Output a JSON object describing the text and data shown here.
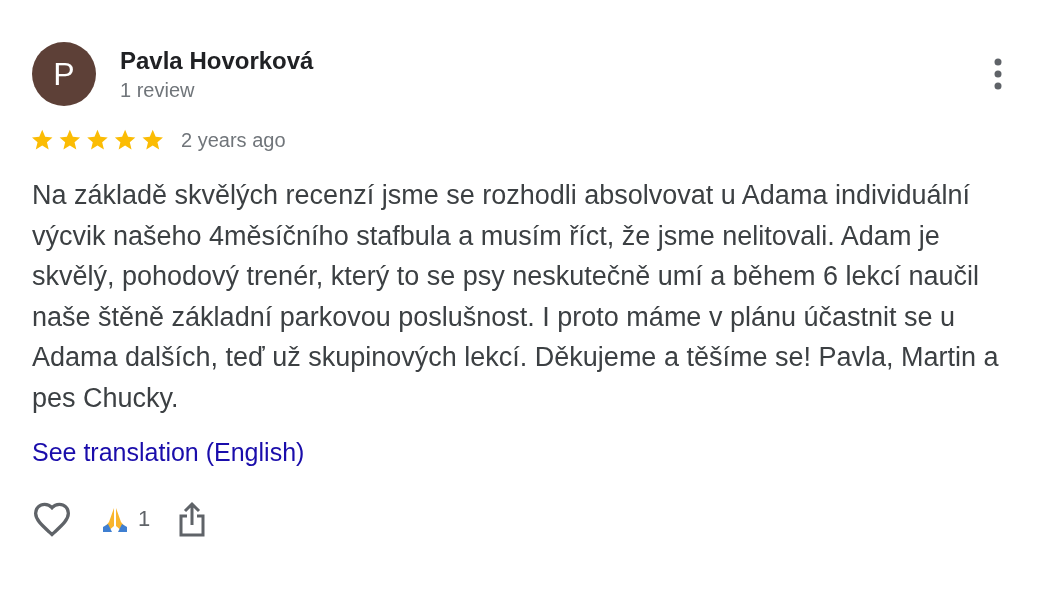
{
  "reviewer": {
    "initial": "P",
    "name": "Pavla Hovorková",
    "review_count": "1 review"
  },
  "rating": {
    "stars": 5,
    "time": "2 years ago"
  },
  "review_text": "Na základě skvělých recenzí jsme se rozhodli absolvovat u Adama individuální výcvik našeho 4měsíčního stafbula a musím říct, že jsme nelitovali. Adam je skvělý, pohodový trenér, který to se psy neskutečně umí a během 6 lekcí naučil naše štěně základní parkovou poslušnost. I proto máme v plánu účastnit se u Adama dalších, teď už skupinových lekcí. Děkujeme a těšíme se! Pavla, Martin a pes Chucky.",
  "translation_link": "See translation (English)",
  "reactions": {
    "liked": false,
    "count": "1"
  }
}
